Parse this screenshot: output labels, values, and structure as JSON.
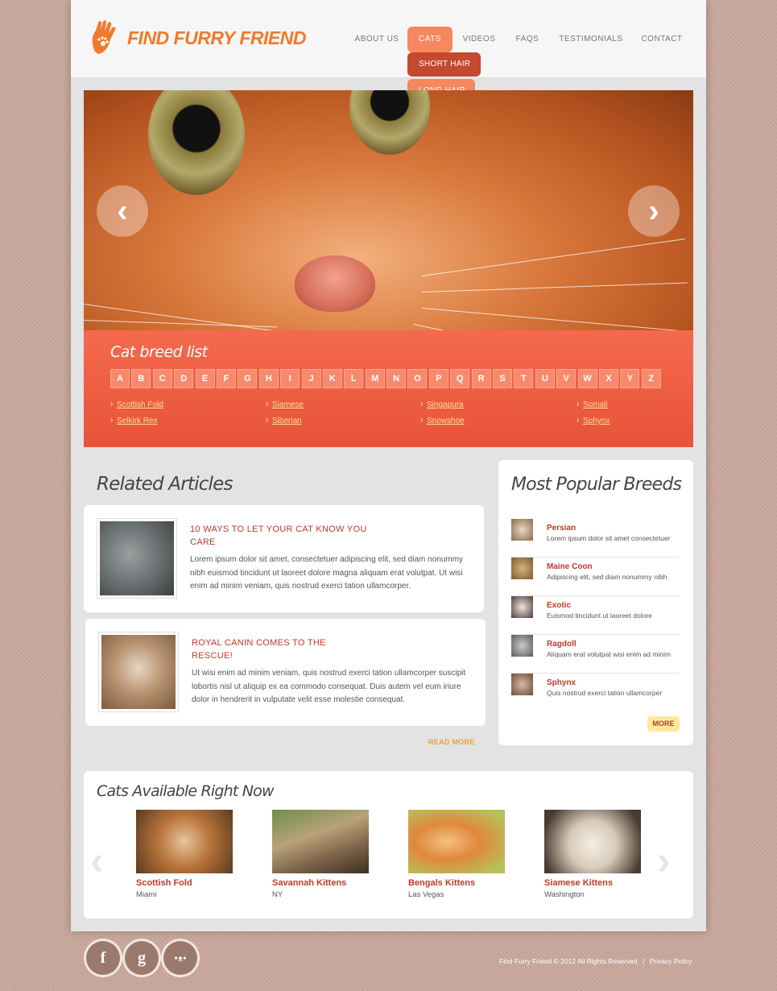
{
  "site": {
    "logo_text": "Find Furry Friend"
  },
  "nav": {
    "items": [
      {
        "label": "ABOUT US"
      },
      {
        "label": "CATS"
      },
      {
        "label": "VIDEOS"
      },
      {
        "label": "FAQS"
      },
      {
        "label": "TESTIMONIALS"
      },
      {
        "label": "CONTACT"
      }
    ],
    "dropdown": [
      {
        "label": "SHORT HAIR"
      },
      {
        "label": "LONG HAIR"
      }
    ]
  },
  "slider": {
    "prev_icon": "‹",
    "next_icon": "›"
  },
  "breed_list": {
    "title": "Cat breed list",
    "letters": [
      "A",
      "B",
      "C",
      "D",
      "E",
      "F",
      "G",
      "H",
      "I",
      "J",
      "K",
      "L",
      "M",
      "N",
      "O",
      "P",
      "Q",
      "R",
      "S",
      "T",
      "U",
      "V",
      "W",
      "X",
      "Y",
      "Z"
    ],
    "links": [
      "Scottish Fold",
      "Siamese",
      "Singapura",
      "Somali",
      "Selkirk Rex",
      "Siberian",
      "Snowshoe",
      "Sphynx"
    ]
  },
  "articles": {
    "title": "Related Articles",
    "items": [
      {
        "title": "10 WAYS TO LET YOUR CAT KNOW YOU CARE",
        "text": "Lorem ipsum dolor sit amet, consectetuer adipiscing elit, sed diam nonummy nibh euismod tincidunt ut laoreet dolore magna aliquam erat volutpat. Ut wisi enim ad minim veniam, quis nostrud exerci tation ullamcorper."
      },
      {
        "title": "ROYAL CANIN COMES TO THE RESCUE!",
        "text": "Ut wisi enim ad minim veniam, quis nostrud exerci tation ullamcorper suscipit lobortis nisl ut aliquip ex ea commodo consequat. Duis autem vel eum iriure dolor in hendrerit in vulputate velit esse molestie consequat."
      }
    ],
    "read_more": "READ MORE"
  },
  "popular": {
    "title": "Most Popular Breeds",
    "items": [
      {
        "name": "Persian",
        "desc": "Lorem ipsum dolor sit amet consectetuer"
      },
      {
        "name": "Maine Coon",
        "desc": "Adipiscing elit, sed diam nonummy nibh"
      },
      {
        "name": "Exotic",
        "desc": "Euismod tincidunt ut laoreet dolore"
      },
      {
        "name": "Ragdoll",
        "desc": "Aliquam erat volutpat wisi enim ad minim"
      },
      {
        "name": "Sphynx",
        "desc": "Quis nostrud exerci tation ullamcorper"
      }
    ],
    "more": "MORE"
  },
  "available": {
    "title": "Cats Available Right Now",
    "items": [
      {
        "name": "Scottish Fold",
        "location": "Miami"
      },
      {
        "name": "Savannah Kittens",
        "location": "NY"
      },
      {
        "name": "Bengals Kittens",
        "location": "Las Vegas"
      },
      {
        "name": "Siamese Kittens",
        "location": "Washington"
      }
    ]
  },
  "footer": {
    "social": [
      {
        "icon": "f"
      },
      {
        "icon": "g"
      },
      {
        "icon": "•ᴥ•"
      }
    ],
    "copyright": "Find Furry Friend © 2012 All Rights Reserved",
    "separator": "|",
    "privacy": "Privacy Policy"
  },
  "colors": {
    "accent": "#f7875f",
    "brand": "#f07a2c",
    "breed_bg": "#e8533a",
    "link_red": "#c0392b"
  }
}
